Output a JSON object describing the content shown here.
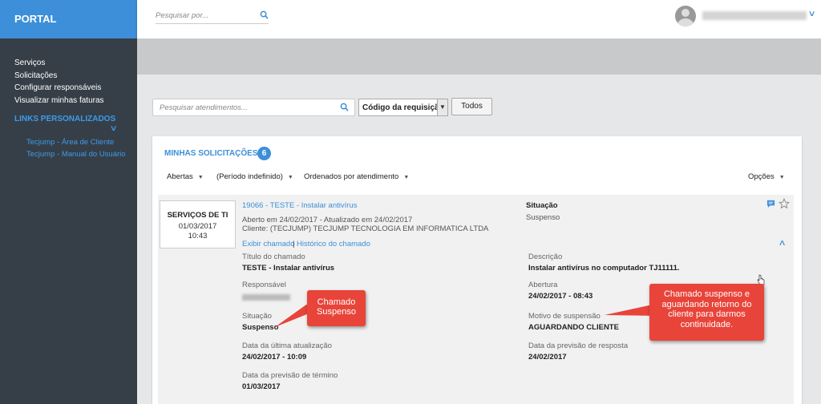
{
  "brand": "PORTAL",
  "sidebar": {
    "items": [
      "Serviços",
      "Solicitações",
      "Configurar responsáveis",
      "Visualizar minhas faturas"
    ],
    "links_title": "LINKS PERSONALIZADOS",
    "links": [
      "Tecjump - Área de Cliente",
      "Tecjump - Manual do Usuário"
    ]
  },
  "header": {
    "search_placeholder": "Pesquisar por...",
    "search_icon": "search-icon",
    "avatar_icon": "user-avatar-icon"
  },
  "filters": {
    "search_placeholder": "Pesquisar atendimentos...",
    "select_value": "Código da requisição",
    "button_label": "Todos"
  },
  "panel": {
    "title": "MINHAS SOLICITAÇÕES",
    "count": "6",
    "status_filter": "Abertas",
    "period_filter": "(Período indefinido)",
    "order_filter": "Ordenados por atendimento",
    "options": "Opções"
  },
  "ticket": {
    "service_name": "SERVIÇOS DE TI",
    "service_date": "01/03/2017",
    "service_time": "10:43",
    "title_link": "19066 - TESTE - Instalar antivírus",
    "opened_line": "Aberto em 24/02/2017 - Atualizado em 24/02/2017",
    "client_line": "Cliente: (TECJUMP) TECJUMP TECNOLOGIA EM INFORMATICA LTDA",
    "situation_label": "Situação",
    "situation_value": "Suspenso",
    "view_link": "Exibir chamado",
    "separator": "|",
    "history_link": "Histórico do chamado",
    "details": {
      "title_label": "Título do chamado",
      "title_value": "TESTE - Instalar antivírus",
      "description_label": "Descrição",
      "description_value": "Instalar antivírus no computador TJ11111.",
      "responsible_label": "Responsável",
      "opening_label": "Abertura",
      "opening_value": "24/02/2017 - 08:43",
      "situation_label": "Situação",
      "situation_value": "Suspenso",
      "suspension_label": "Motivo de suspensão",
      "suspension_value": "AGUARDANDO CLIENTE",
      "last_update_label": "Data da última atualização",
      "last_update_value": "24/02/2017 - 10:09",
      "response_forecast_label": "Data da previsão de resposta",
      "response_forecast_value": "24/02/2017",
      "end_forecast_label": "Data da previsão de término",
      "end_forecast_value": "01/03/2017"
    }
  },
  "callouts": {
    "left": "Chamado Suspenso",
    "right": "Chamado suspenso e aguardando retorno do cliente para darmos continuidade."
  },
  "colors": {
    "accent": "#3d8fd9",
    "sidebar": "#363f48",
    "callout": "#e8443a"
  }
}
